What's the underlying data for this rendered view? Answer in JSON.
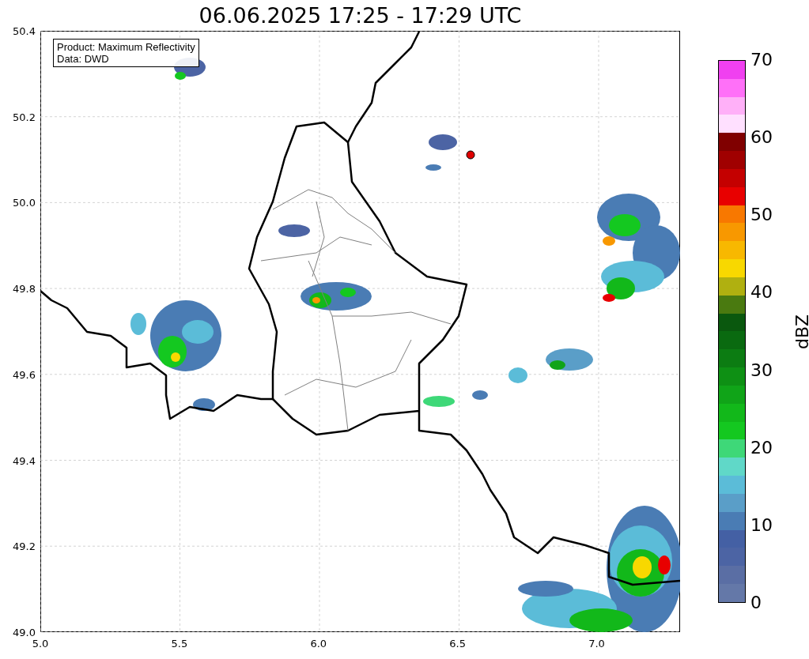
{
  "title": "06.06.2025 17:25 - 17:29 UTC",
  "info_box": {
    "lines": [
      "Product: Maximum Reflectivity",
      "Data: DWD"
    ]
  },
  "map": {
    "x_ticks": [
      "5.0",
      "5.5",
      "6.0",
      "6.5",
      "7.0"
    ],
    "y_ticks": [
      "50.4",
      "50.2",
      "50.0",
      "49.8",
      "49.6",
      "49.4",
      "49.2",
      "49.0"
    ]
  },
  "colorbar": {
    "label": "dBZ",
    "ticks": [
      "70",
      "60",
      "50",
      "40",
      "30",
      "20",
      "10",
      "0"
    ],
    "bins": [
      {
        "color": "#f040f0"
      },
      {
        "color": "#ff70f8"
      },
      {
        "color": "#ffb0f8"
      },
      {
        "color": "#ffe0ff"
      },
      {
        "color": "#800000"
      },
      {
        "color": "#a00000"
      },
      {
        "color": "#c40000"
      },
      {
        "color": "#e80000"
      },
      {
        "color": "#f87800"
      },
      {
        "color": "#f89800"
      },
      {
        "color": "#f8b800"
      },
      {
        "color": "#f8d800"
      },
      {
        "color": "#b0b010"
      },
      {
        "color": "#4a7a10"
      },
      {
        "color": "#0a580e"
      },
      {
        "color": "#0a6a10"
      },
      {
        "color": "#0c7c12"
      },
      {
        "color": "#0e9014"
      },
      {
        "color": "#10a418"
      },
      {
        "color": "#12b81a"
      },
      {
        "color": "#14c820"
      },
      {
        "color": "#3ed878"
      },
      {
        "color": "#60d8c8"
      },
      {
        "color": "#5bbcd8"
      },
      {
        "color": "#5a9ec8"
      },
      {
        "color": "#4a7cb4"
      },
      {
        "color": "#4460a4"
      },
      {
        "color": "#4c64a4"
      },
      {
        "color": "#5a6ea4"
      },
      {
        "color": "#6478a8"
      }
    ]
  }
}
